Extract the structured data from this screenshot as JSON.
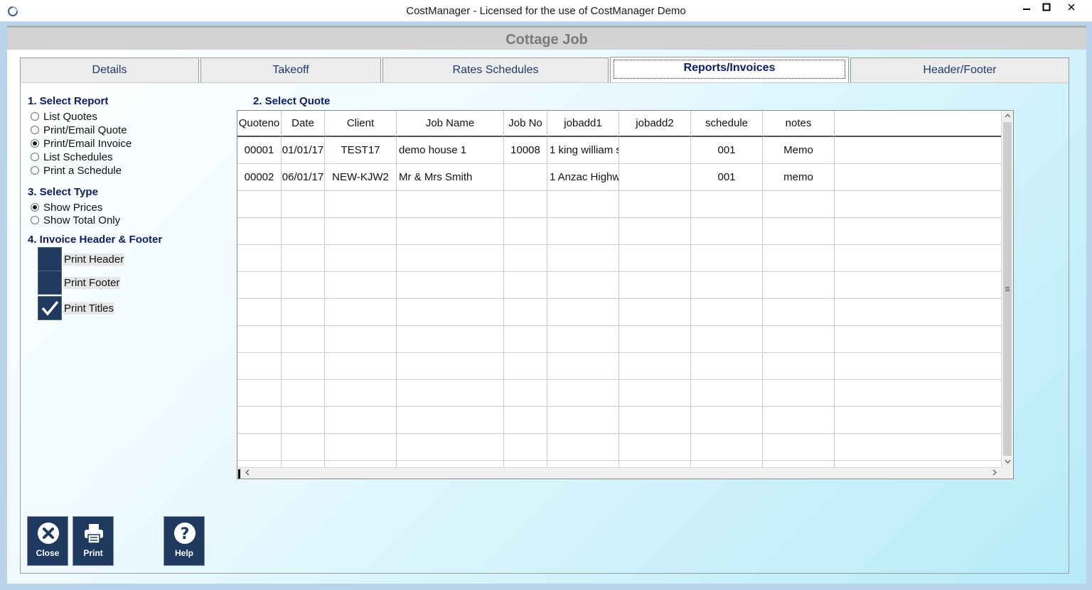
{
  "window": {
    "title": "CostManager - Licensed for the use of CostManager Demo",
    "minimize": "▁",
    "maximize": "□",
    "close": "✕"
  },
  "form": {
    "title": "Cottage Job"
  },
  "tabs": [
    {
      "label": "Details",
      "active": false
    },
    {
      "label": "Takeoff",
      "active": false
    },
    {
      "label": "Rates Schedules",
      "active": false
    },
    {
      "label": "Reports/Invoices",
      "active": true
    },
    {
      "label": "Header/Footer",
      "active": false
    }
  ],
  "select_report": {
    "title": "1. Select Report",
    "options": [
      "List Quotes",
      "Print/Email Quote",
      "Print/Email Invoice",
      "List Schedules",
      "Print a Schedule"
    ],
    "selected": "Print/Email Invoice"
  },
  "select_type": {
    "title": "3. Select Type",
    "options": [
      "Show Prices",
      "Show Total Only"
    ],
    "selected": "Show Prices"
  },
  "header_footer": {
    "title": "4. Invoice Header & Footer",
    "checkboxes": [
      {
        "label": "Print Header",
        "checked": false
      },
      {
        "label": "Print Footer",
        "checked": false
      },
      {
        "label": "Print Titles",
        "checked": true
      }
    ]
  },
  "select_quote": {
    "title": "2. Select Quote",
    "columns": [
      "Quoteno",
      "Date",
      "Client",
      "Job Name",
      "Job No",
      "jobadd1",
      "jobadd2",
      "schedule",
      "notes"
    ],
    "rows": [
      [
        "00001",
        "01/01/17",
        "TEST17",
        "demo house 1",
        "10008",
        "1 king william s",
        "",
        "001",
        "Memo"
      ],
      [
        "00002",
        "06/01/17",
        "NEW-KJW2",
        "Mr & Mrs Smith",
        "",
        "1 Anzac Highw",
        "",
        "001",
        "memo"
      ]
    ]
  },
  "buttons": {
    "close": "Close",
    "print": "Print",
    "help": "Help"
  }
}
